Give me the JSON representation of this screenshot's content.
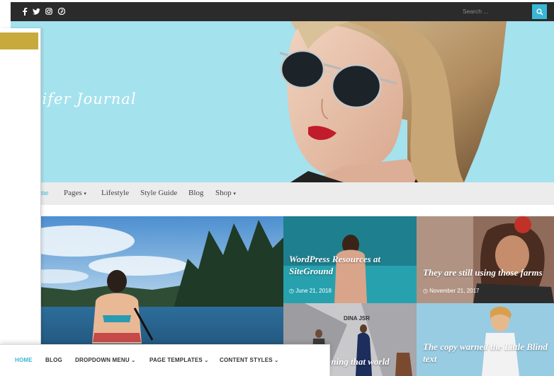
{
  "topbar": {
    "social": [
      "facebook-icon",
      "twitter-icon",
      "instagram-icon",
      "pinterest-icon"
    ],
    "search_placeholder": "Search ..."
  },
  "hero": {
    "site_title": "nifer Journal"
  },
  "nav": {
    "items": [
      "ne",
      "Pages",
      "Lifestyle",
      "Style Guide",
      "Blog",
      "Shop"
    ]
  },
  "tiles": [
    {
      "title": "WordPress Resources at SiteGround",
      "date": "June 21, 2018"
    },
    {
      "title": "They are still using those farms",
      "date": "November 21, 2017"
    },
    {
      "title": "DINA JSR"
    },
    {
      "title": "nning that world"
    },
    {
      "title": "The copy warned the Little Blind text"
    }
  ],
  "bottom_nav": {
    "items": [
      "HOME",
      "BLOG",
      "DROPDOWN MENU",
      "PAGE TEMPLATES",
      "CONTENT STYLES"
    ]
  },
  "colors": {
    "topbar": "#2b2b2b",
    "accent": "#38b7d6",
    "hero_bg": "#a4e2ee",
    "nav_bg": "#ececec",
    "gold": "#c8aa3c"
  }
}
